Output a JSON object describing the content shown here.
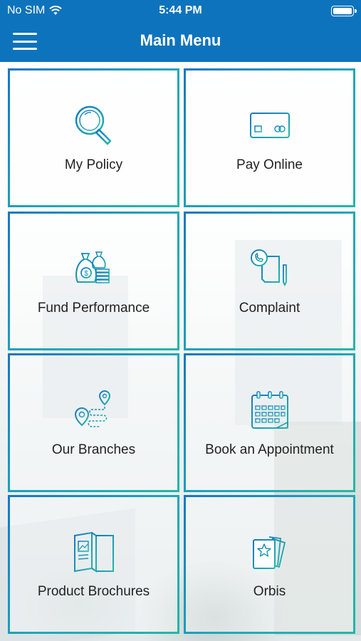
{
  "status_bar": {
    "carrier": "No SIM",
    "time": "5:44 PM"
  },
  "nav": {
    "title": "Main Menu",
    "menu_icon": "hamburger-icon"
  },
  "colors": {
    "primary": "#0d73bd",
    "tile_gradient_start": "#1677c4",
    "tile_gradient_end": "#24b6a8"
  },
  "tiles": [
    {
      "label": "My Policy",
      "icon": "magnifier-icon"
    },
    {
      "label": "Pay Online",
      "icon": "credit-card-icon"
    },
    {
      "label": "Fund Performance",
      "icon": "money-bags-icon"
    },
    {
      "label": "Complaint",
      "icon": "phone-document-icon"
    },
    {
      "label": "Our Branches",
      "icon": "map-route-icon"
    },
    {
      "label": "Book an Appointment",
      "icon": "calendar-icon"
    },
    {
      "label": "Product Brochures",
      "icon": "brochure-icon"
    },
    {
      "label": "Orbis",
      "icon": "star-cards-icon"
    }
  ]
}
